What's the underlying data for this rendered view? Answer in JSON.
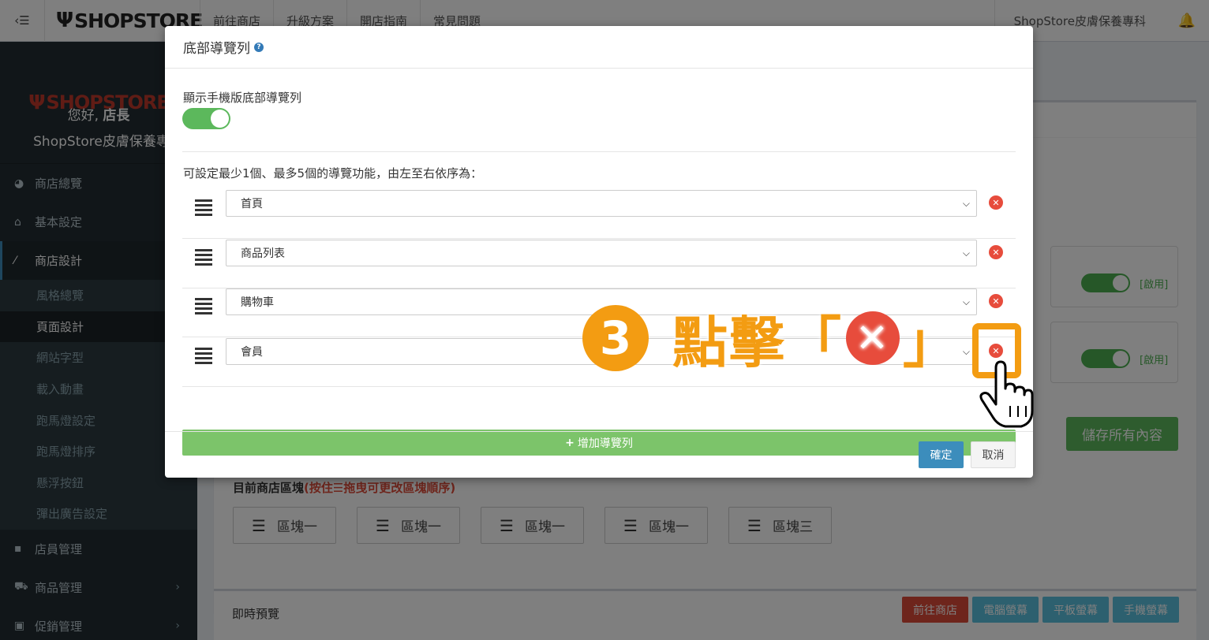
{
  "topbar": {
    "toggle_label": "‹☰",
    "logo": "SHOPSTORE",
    "nav": [
      "前往商店",
      "升級方案",
      "開店指南",
      "常見問題"
    ],
    "store_name": "ShopStore皮膚保養專科",
    "bell_icon": "bell-icon"
  },
  "sidebar": {
    "logo": "SHOPSTORE",
    "greeting_prefix": "您好,",
    "greeting_name": "店長",
    "store": "ShopStore皮膚保養專科",
    "menu": [
      {
        "label": "商店總覽",
        "icon": "dashboard-icon"
      },
      {
        "label": "基本設定",
        "icon": "bank-icon"
      },
      {
        "label": "商店設計",
        "icon": "magic-icon"
      }
    ],
    "submenu": [
      "風格總覽",
      "頁面設計",
      "網站字型",
      "載入動畫",
      "跑馬燈設定",
      "跑馬燈排序",
      "懸浮按鈕",
      "彈出廣告設定"
    ],
    "menu_bottom": [
      {
        "label": "店員管理",
        "icon": "lock-icon"
      },
      {
        "label": "商品管理",
        "icon": "cart-icon"
      },
      {
        "label": "促銷管理",
        "icon": "gift-icon"
      }
    ]
  },
  "main": {
    "option_label": "[啟用]",
    "save_all": "儲存所有內容",
    "blocks_title": "目前商店區塊",
    "blocks_hint": "(按住☰拖曳可更改區塊順序)",
    "blocks": [
      "區塊一",
      "區塊一",
      "區塊一",
      "區塊一",
      "區塊三"
    ],
    "preview_title": "即時預覽",
    "preview_buttons": [
      "前往商店",
      "電腦螢幕",
      "平板螢幕",
      "手機螢幕"
    ]
  },
  "modal": {
    "title": "底部導覽列",
    "help": "?",
    "show_label": "顯示手機版底部導覽列",
    "show_enabled": true,
    "desc": "可設定最少1個、最多5個的導覽功能，由左至右依序為：",
    "rows": [
      {
        "value": "首頁"
      },
      {
        "value": "商品列表"
      },
      {
        "value": "購物車"
      },
      {
        "value": "會員"
      }
    ],
    "add_label": "增加導覽列",
    "ok": "確定",
    "cancel": "取消"
  },
  "annotation": {
    "step": "3",
    "text": "點擊",
    "open_bracket": "「",
    "close_bracket": "」",
    "x": "✕"
  },
  "colors": {
    "accent": "#f39c12",
    "danger": "#e74c3c",
    "success": "#5cb85c",
    "primary": "#3c8dbc"
  }
}
